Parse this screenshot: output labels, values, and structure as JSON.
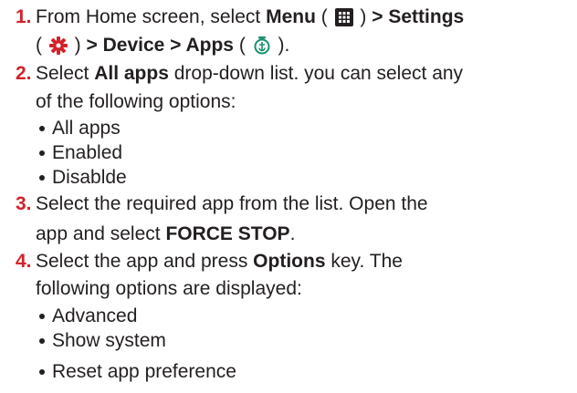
{
  "steps": [
    {
      "number": "1.",
      "l1_pre": "From Home screen, select ",
      "menu": "Menu",
      "l1_paren_open": " ( ",
      "l1_paren_close": " ) ",
      "gt1": "> ",
      "settings": "Settings",
      "l2_paren_open": "( ",
      "l2_paren_close": " ) ",
      "gt2": "> ",
      "device": "Device",
      "gt3": " > ",
      "apps": "Apps",
      "l2_paren_open2": " ( ",
      "l2_end": " )."
    },
    {
      "number": "2.",
      "select": "Select ",
      "all_apps": "All apps",
      "rest1": " drop-down list. you can select any",
      "line2": "of the following options:"
    },
    {
      "number": "3.",
      "line1": "Select the required app from the list. Open the",
      "line2_pre": "app and select ",
      "force_stop": "FORCE STOP",
      "line2_post": "."
    },
    {
      "number": "4.",
      "pre": "Select the app and press ",
      "options": "Options",
      "post": " key. The",
      "line2": "following options are displayed:"
    }
  ],
  "bullets_step2": [
    "All apps",
    "Enabled",
    "Disablde"
  ],
  "bullets_step4": [
    "Advanced",
    "Show system",
    "Reset app preference"
  ],
  "icons": {
    "menu": "menu-grid-icon",
    "settings": "settings-gear-icon",
    "apps": "apps-icon"
  },
  "colors": {
    "step_number": "#d2232a",
    "settings_icon": "#d2232a",
    "apps_icon": "#1a8f6e",
    "menu_icon": "#231f20"
  }
}
